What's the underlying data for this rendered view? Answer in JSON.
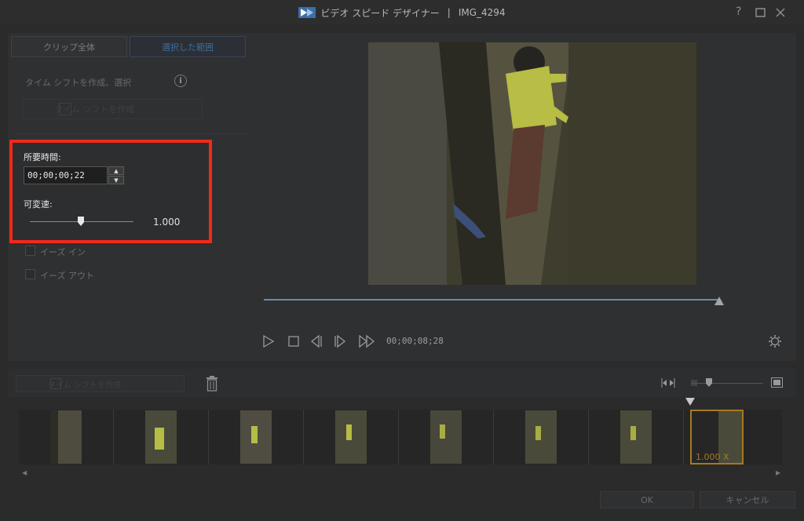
{
  "window": {
    "app_name": "ビデオ スピード デザイナー",
    "separator": "|",
    "file_name": "IMG_4294",
    "help_icon": "help-icon",
    "maximize_icon": "maximize-icon",
    "close_icon": "close-icon"
  },
  "tabs": [
    {
      "label": "クリップ全体",
      "active": false
    },
    {
      "label": "選択した範囲",
      "active": true
    }
  ],
  "left_panel": {
    "timeshift_label": "タイム シフトを作成、選択",
    "info_icon": "i",
    "create_timeshift_button": "タイム シフトを作成",
    "duration_label": "所要時間:",
    "duration_value": "00;00;00;22",
    "variable_speed_label": "可変速:",
    "speed_value": "1.000",
    "speed_level": 0.47,
    "ease_in_label": "イーズ イン",
    "ease_out_label": "イーズ アウト",
    "highlight_color": "#f02a1a"
  },
  "player": {
    "current_time": "00;00;08;28",
    "progress_fraction": 1.0
  },
  "timeline": {
    "create_timeshift_button": "タイム シフトを作成",
    "selection_speed": "1.000 X",
    "selection_color": "#a57a1f"
  },
  "footer": {
    "ok_label": "OK",
    "cancel_label": "キャンセル"
  }
}
